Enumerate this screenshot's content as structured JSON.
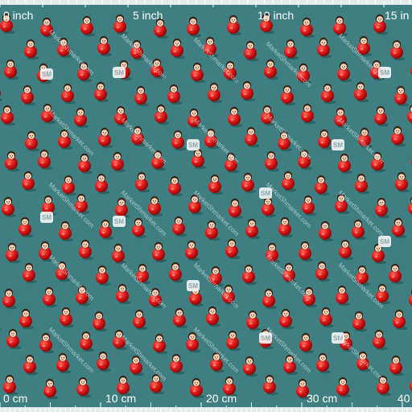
{
  "colors": {
    "background": "#3f7f82",
    "ruler_band": "#ffffff",
    "doll_red": "#e01616",
    "doll_dark_red": "#8e0a0a",
    "face": "#f3d2b5",
    "hair": "#3b2318"
  },
  "ruler_top": {
    "labels": [
      "0 inch",
      "5 inch",
      "10 inch",
      "15 in"
    ]
  },
  "ruler_bottom": {
    "labels": [
      "0 cm",
      "10 cm",
      "20 cm",
      "30 cm",
      "40"
    ]
  },
  "pattern": {
    "motif": "roly-poly-doll",
    "watermark_text": "MarketShmarket.com",
    "logo_text": "SM"
  }
}
